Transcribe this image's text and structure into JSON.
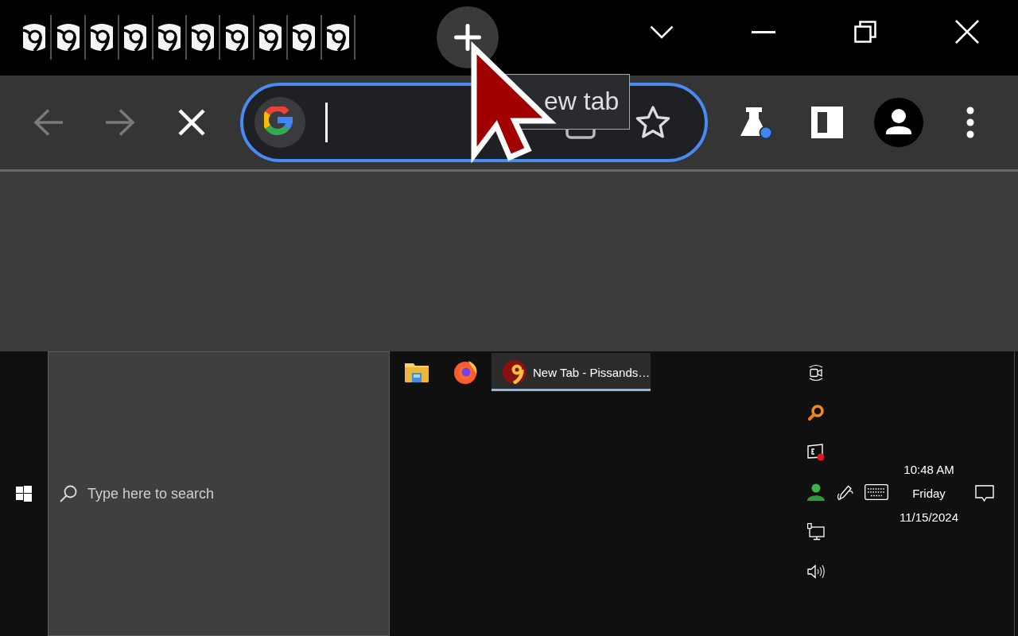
{
  "browser": {
    "tabs": [
      {
        "selected": false
      },
      {
        "selected": false
      },
      {
        "selected": false
      },
      {
        "selected": false
      },
      {
        "selected": false
      },
      {
        "selected": false
      },
      {
        "selected": false
      },
      {
        "selected": false
      },
      {
        "selected": false
      },
      {
        "selected": false
      }
    ],
    "tooltip": {
      "text": "ew tab"
    },
    "toolbar": {
      "back": {
        "disabled": true
      },
      "forward": {
        "disabled": true
      },
      "address_bar": {
        "focused": true,
        "bookmarked": false
      }
    }
  },
  "taskbar": {
    "search": {
      "placeholder": "Type here to search"
    },
    "apps": [
      {
        "kind": "folder",
        "selected": false
      },
      {
        "kind": "firefox",
        "selected": false
      },
      {
        "kind": "chrome",
        "label": "New Tab - Pissands…",
        "selected": true
      }
    ],
    "clock": {
      "time": "10:48 AM",
      "day": "Friday",
      "date": "11/15/2024"
    }
  }
}
